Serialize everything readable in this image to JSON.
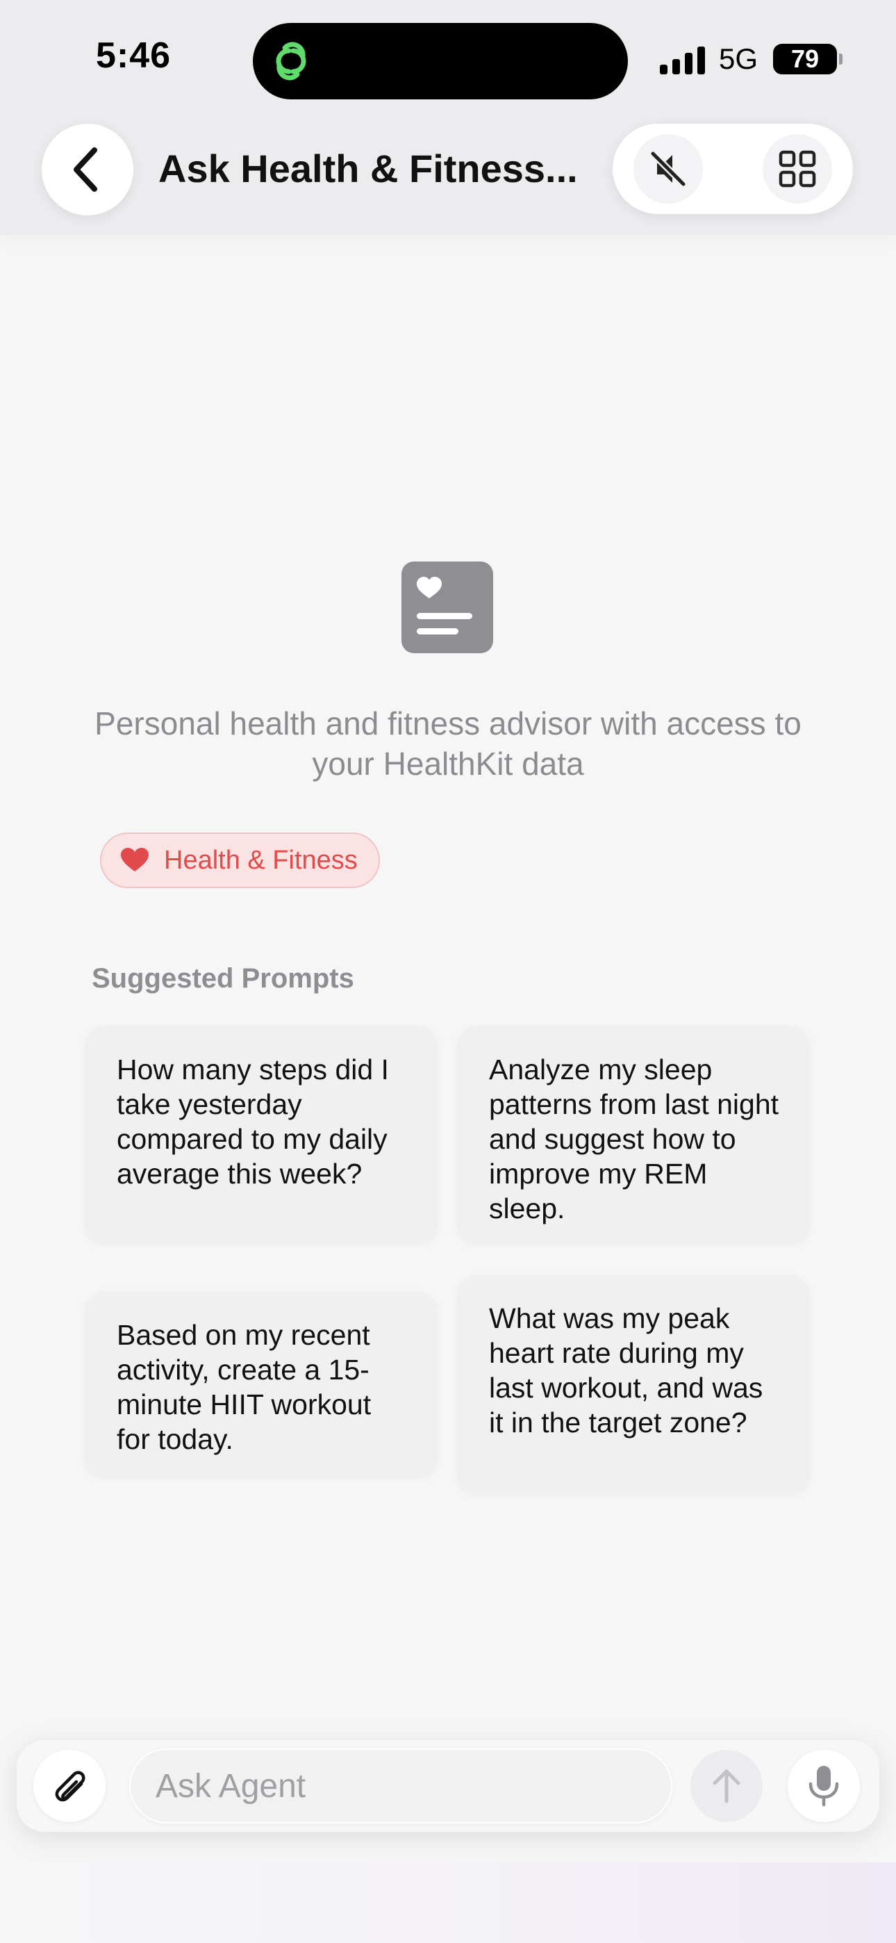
{
  "status_bar": {
    "time": "5:46",
    "network": "5G",
    "battery": "79",
    "icons": [
      "link-icon",
      "signal-icon",
      "battery-icon"
    ]
  },
  "header": {
    "title": "Ask Health & Fitness...",
    "back_icon": "chevron-left-icon",
    "mute_icon": "speaker-slash-icon",
    "grid_icon": "grid-icon"
  },
  "agent": {
    "icon": "health-document-icon",
    "description": "Personal health and fitness advisor with access to your HealthKit data",
    "category": {
      "label": "Health & Fitness",
      "icon": "heart-icon",
      "color": "#e14b4b"
    }
  },
  "prompts": {
    "title": "Suggested Prompts",
    "items": [
      {
        "text": "How many steps did I take yesterday compared to my daily average this week?"
      },
      {
        "text": "Analyze my sleep patterns from last night and suggest how to improve my REM sleep."
      },
      {
        "text": "Based on my recent activity, create a 15-minute HIIT workout for today."
      },
      {
        "text": "What was my peak heart rate during my last workout, and was it in the target zone?"
      }
    ]
  },
  "composer": {
    "placeholder": "Ask Agent",
    "attach_icon": "paperclip-icon",
    "send_icon": "arrow-up-icon",
    "mic_icon": "microphone-icon"
  }
}
